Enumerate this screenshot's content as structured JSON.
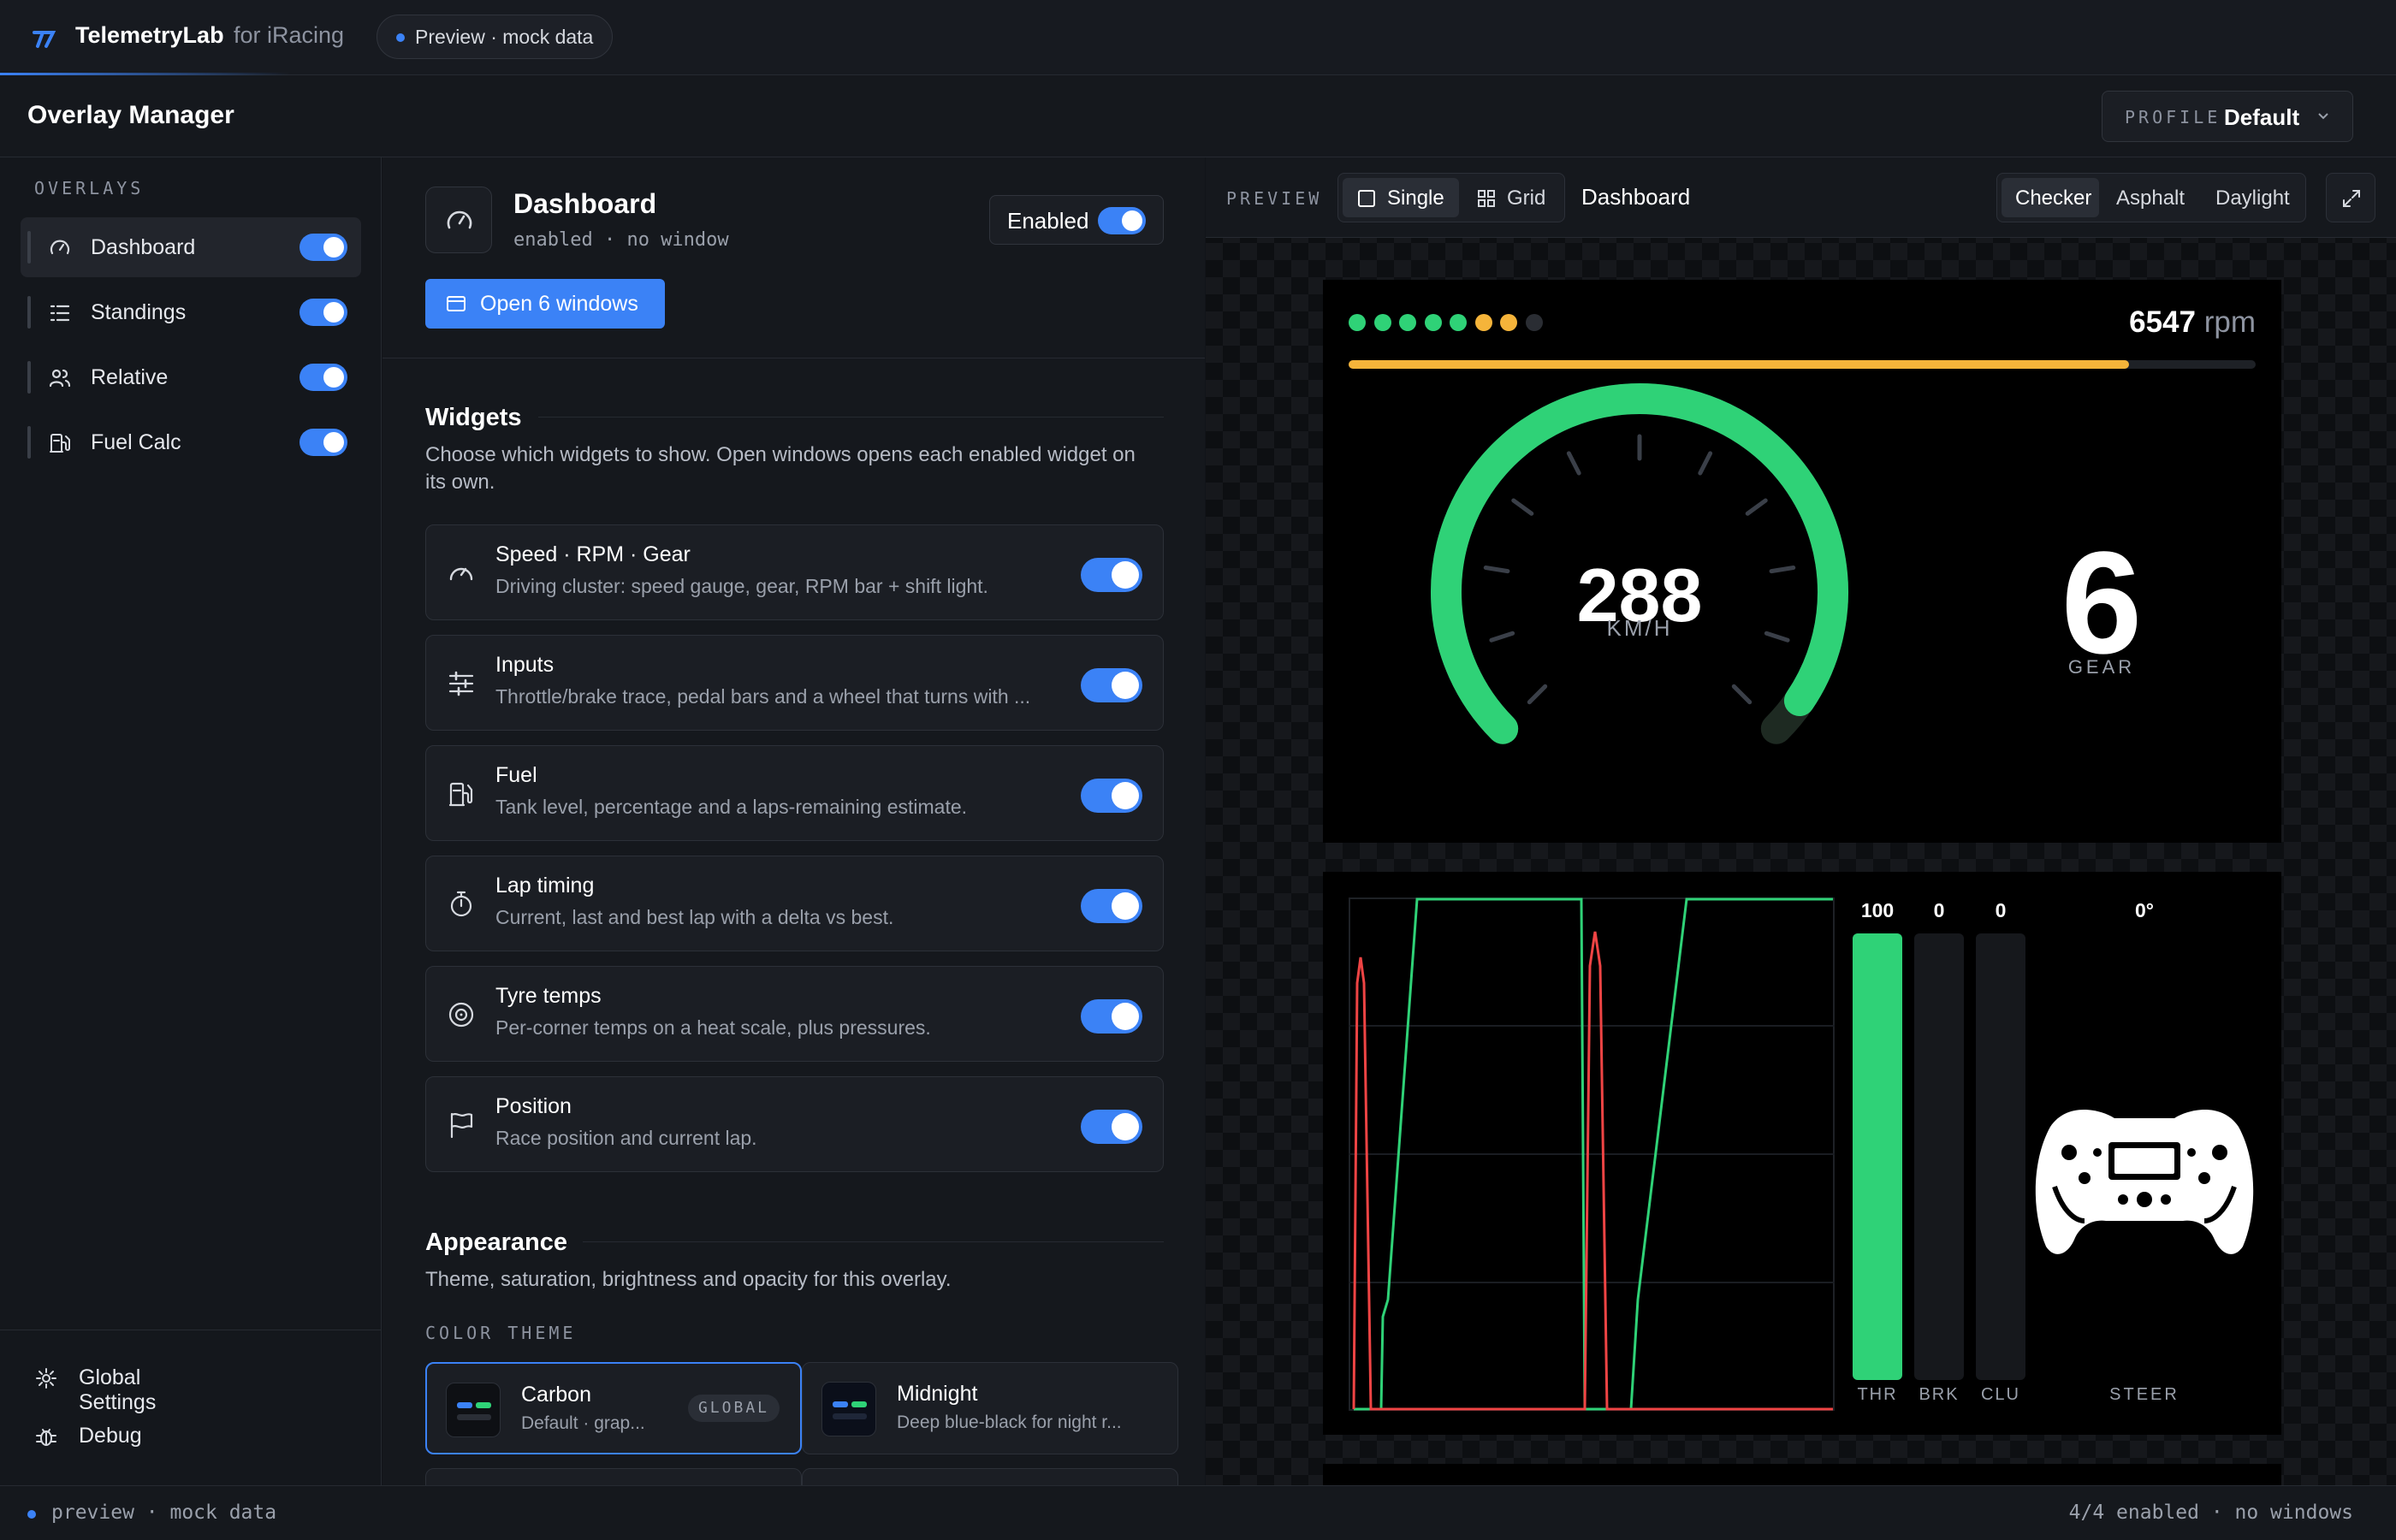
{
  "app": {
    "name": "TelemetryLab",
    "subtitle": "for iRacing",
    "mode_pill": "Preview · mock data"
  },
  "header": {
    "title": "Overlay Manager",
    "profile_label": "PROFILE",
    "profile_value": "Default"
  },
  "sidebar": {
    "section_label": "OVERLAYS",
    "items": [
      {
        "label": "Dashboard",
        "icon": "gauge-icon",
        "enabled": true,
        "active": true
      },
      {
        "label": "Standings",
        "icon": "list-icon",
        "enabled": true
      },
      {
        "label": "Relative",
        "icon": "users-icon",
        "enabled": true
      },
      {
        "label": "Fuel Calc",
        "icon": "fuel-icon",
        "enabled": true
      }
    ],
    "footer": [
      {
        "label": "Global Settings",
        "icon": "gear-icon"
      },
      {
        "label": "Debug",
        "icon": "bug-icon"
      }
    ]
  },
  "overlay": {
    "title": "Dashboard",
    "status": "enabled · no window",
    "enabled_label": "Enabled",
    "enabled": true,
    "open_button": "Open 6 windows"
  },
  "widgets": {
    "heading": "Widgets",
    "description": "Choose which widgets to show. Open windows opens each enabled widget on its own.",
    "items": [
      {
        "title": "Speed · RPM · Gear",
        "desc": "Driving cluster: speed gauge, gear, RPM bar + shift light.",
        "icon": "gauge-icon",
        "enabled": true
      },
      {
        "title": "Inputs",
        "desc": "Throttle/brake trace, pedal bars and a wheel that turns with ...",
        "icon": "sliders-icon",
        "enabled": true
      },
      {
        "title": "Fuel",
        "desc": "Tank level, percentage and a laps-remaining estimate.",
        "icon": "fuel-icon",
        "enabled": true
      },
      {
        "title": "Lap timing",
        "desc": "Current, last and best lap with a delta vs best.",
        "icon": "stopwatch-icon",
        "enabled": true
      },
      {
        "title": "Tyre temps",
        "desc": "Per-corner temps on a heat scale, plus pressures.",
        "icon": "tyre-icon",
        "enabled": true
      },
      {
        "title": "Position",
        "desc": "Race position and current lap.",
        "icon": "flag-icon",
        "enabled": true
      }
    ]
  },
  "appearance": {
    "heading": "Appearance",
    "description": "Theme, saturation, brightness and opacity for this overlay.",
    "color_theme_label": "COLOR THEME",
    "themes": [
      {
        "name": "Carbon",
        "desc": "Default · grap...",
        "badge": "GLOBAL",
        "selected": true
      },
      {
        "name": "Midnight",
        "desc": "Deep blue-black for night r...",
        "selected": false
      }
    ]
  },
  "preview": {
    "label": "PREVIEW",
    "view_modes": [
      "Single",
      "Grid"
    ],
    "active_view": "Single",
    "overlay_name": "Dashboard",
    "backgrounds": [
      "Checker",
      "Asphalt",
      "Daylight"
    ],
    "active_background": "Checker"
  },
  "telemetry": {
    "rpm_value": "6547",
    "rpm_unit": "rpm",
    "rpm_fraction": 0.86,
    "shift_lights": [
      "green",
      "green",
      "green",
      "green",
      "green",
      "amber",
      "amber",
      "off"
    ],
    "speed": "288",
    "speed_unit": "KM/H",
    "speed_fraction": 0.96,
    "gear": "6",
    "gear_label": "GEAR",
    "throttle": "100",
    "brake": "0",
    "clutch": "0",
    "throttle_label": "THR",
    "brake_label": "BRK",
    "clutch_label": "CLU",
    "steer_value": "0°",
    "steer_label": "STEER"
  },
  "statusbar": {
    "left": "preview · mock data",
    "right": "4/4 enabled · no windows"
  },
  "colors": {
    "accent": "#3b82f6",
    "green": "#2fd277",
    "amber": "#f5b43a",
    "red": "#ef4444"
  }
}
